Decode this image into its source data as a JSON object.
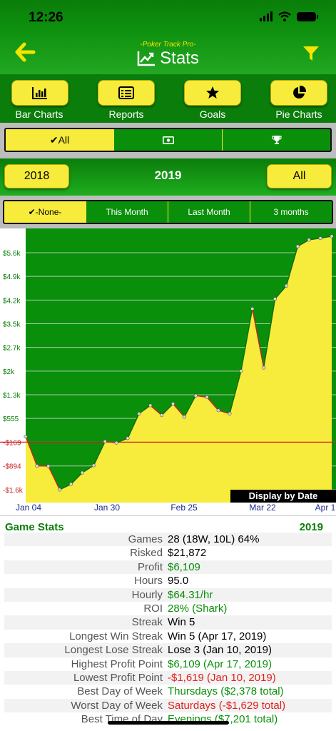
{
  "status_bar": {
    "time": "12:26"
  },
  "header": {
    "app_name": "-Poker Track Pro-",
    "title": "Stats",
    "back_icon": "arrow-left-icon",
    "filter_icon": "filter-icon"
  },
  "toolbar": {
    "items": [
      {
        "label": "Bar Charts",
        "icon": "bar-chart-icon"
      },
      {
        "label": "Reports",
        "icon": "list-icon"
      },
      {
        "label": "Goals",
        "icon": "star-icon"
      },
      {
        "label": "Pie Charts",
        "icon": "pie-chart-icon"
      }
    ]
  },
  "type_filter": {
    "all_label": "✔All",
    "selected": "All"
  },
  "year_row": {
    "prev_year": "2018",
    "current_year": "2019",
    "all_label": "All"
  },
  "range_filter": {
    "items": [
      "✔-None-",
      "This Month",
      "Last Month",
      "3 months"
    ],
    "selected": "-None-"
  },
  "chart": {
    "display_label": "Display by Date",
    "colors": {
      "background": "#0a8f0a",
      "fill": "#f7ec3c",
      "line": "#0a6d0a",
      "drop_line": "#cc2222",
      "zero_line": "#cc2222"
    }
  },
  "chart_data": {
    "type": "area",
    "title": "",
    "xlabel": "",
    "ylabel": "",
    "y_ticks": [
      "$5.6k",
      "$4.9k",
      "$4.2k",
      "$3.5k",
      "$2.7k",
      "$2k",
      "$1.3k",
      "$555",
      "-$169",
      "-$894",
      "-$1.6k"
    ],
    "y_tick_values": [
      5608,
      4886,
      4164,
      3442,
      2720,
      1998,
      1277,
      555,
      -169,
      -894,
      -1619
    ],
    "x_ticks": [
      "Jan 04",
      "Jan 30",
      "Feb 25",
      "Mar 22",
      "Apr 1"
    ],
    "ylim": [
      -1619,
      6109
    ],
    "grid": true,
    "series": [
      {
        "values": [
          0,
          -894,
          -900,
          -1619,
          -1450,
          -1100,
          -880,
          -150,
          -190,
          -50,
          700,
          950,
          650,
          1000,
          600,
          1250,
          1200,
          800,
          700,
          2000,
          3900,
          2100,
          4200,
          4600,
          5800,
          6000,
          6050,
          6109
        ]
      }
    ]
  },
  "stats": {
    "title": "Game Stats",
    "year": "2019",
    "rows": [
      {
        "label": "Games",
        "value": "28 (18W, 10L) 64%",
        "tone": "black"
      },
      {
        "label": "Risked",
        "value": "$21,872",
        "tone": "black"
      },
      {
        "label": "Profit",
        "value": "$6,109",
        "tone": "green"
      },
      {
        "label": "Hours",
        "value": "95.0",
        "tone": "black"
      },
      {
        "label": "Hourly",
        "value": "$64.31/hr",
        "tone": "green"
      },
      {
        "label": "ROI",
        "value": "28% (Shark)",
        "tone": "green"
      },
      {
        "label": "Streak",
        "value": "Win 5",
        "tone": "black"
      },
      {
        "label": "Longest Win Streak",
        "value": "Win 5 (Apr 17, 2019)",
        "tone": "black"
      },
      {
        "label": "Longest Lose Streak",
        "value": "Lose 3 (Jan 10, 2019)",
        "tone": "black"
      },
      {
        "label": "Highest Profit Point",
        "value": "$6,109 (Apr 17, 2019)",
        "tone": "green"
      },
      {
        "label": "Lowest Profit Point",
        "value": "-$1,619 (Jan 10, 2019)",
        "tone": "red"
      },
      {
        "label": "Best Day of Week",
        "value": "Thursdays ($2,378 total)",
        "tone": "green"
      },
      {
        "label": "Worst Day of Week",
        "value": "Saturdays (-$1,629 total)",
        "tone": "red"
      },
      {
        "label": "Best Time of Day",
        "value": "Evenings ($7,201 total)",
        "tone": "green"
      }
    ]
  }
}
